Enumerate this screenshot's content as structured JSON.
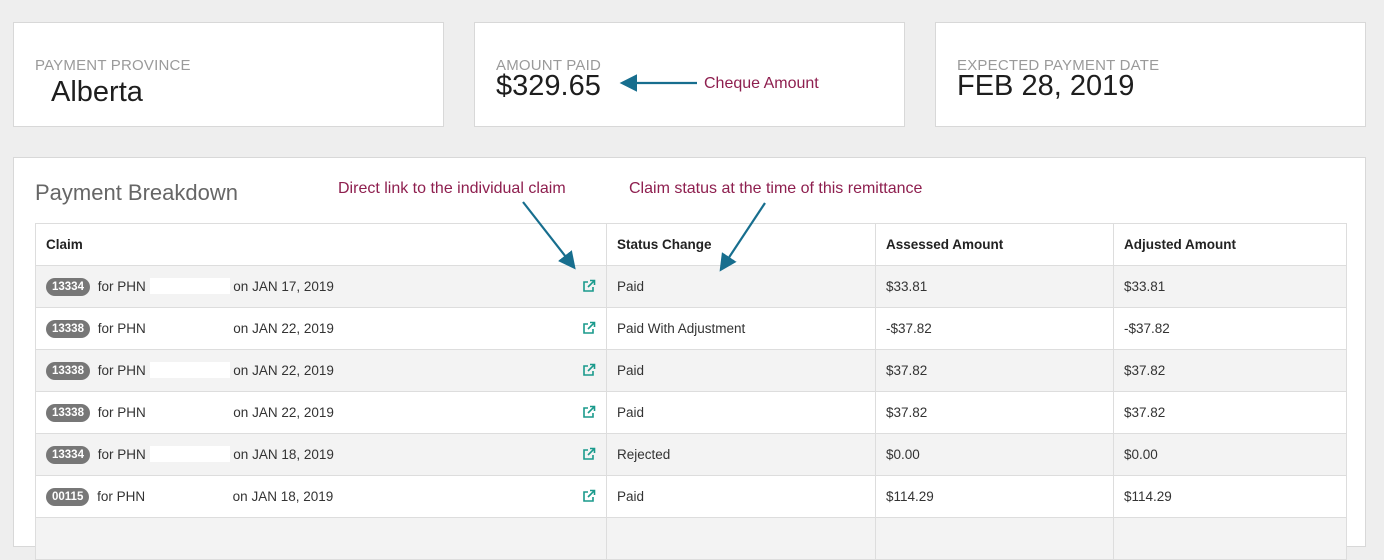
{
  "summary": {
    "province": {
      "label": "PAYMENT PROVINCE",
      "value": "Alberta"
    },
    "amount": {
      "label": "AMOUNT PAID",
      "value": "$329.65",
      "annotation": "Cheque Amount"
    },
    "date": {
      "label": "EXPECTED PAYMENT DATE",
      "value": "FEB 28, 2019"
    }
  },
  "breakdown": {
    "title": "Payment Breakdown",
    "annotations": {
      "link": "Direct link to the individual claim",
      "status": "Claim status at the time of this remittance"
    },
    "columns": [
      "Claim",
      "Status Change",
      "Assessed Amount",
      "Adjusted Amount"
    ],
    "rows": [
      {
        "claim_id": "13334",
        "phn_prefix": "for PHN",
        "date_text": "on JAN 17, 2019",
        "status": "Paid",
        "assessed": "$33.81",
        "adjusted": "$33.81"
      },
      {
        "claim_id": "13338",
        "phn_prefix": "for PHN",
        "date_text": "on JAN 22, 2019",
        "status": "Paid With Adjustment",
        "assessed": "-$37.82",
        "adjusted": "-$37.82"
      },
      {
        "claim_id": "13338",
        "phn_prefix": "for PHN",
        "date_text": "on JAN 22, 2019",
        "status": "Paid",
        "assessed": "$37.82",
        "adjusted": "$37.82"
      },
      {
        "claim_id": "13338",
        "phn_prefix": "for PHN",
        "date_text": "on JAN 22, 2019",
        "status": "Paid",
        "assessed": "$37.82",
        "adjusted": "$37.82"
      },
      {
        "claim_id": "13334",
        "phn_prefix": "for PHN",
        "date_text": "on JAN 18, 2019",
        "status": "Rejected",
        "assessed": "$0.00",
        "adjusted": "$0.00"
      },
      {
        "claim_id": "00115",
        "phn_prefix": "for PHN",
        "date_text": "on JAN 18, 2019",
        "status": "Paid",
        "assessed": "$114.29",
        "adjusted": "$114.29"
      }
    ]
  },
  "colors": {
    "annotation_text": "#8e1f4f",
    "annotation_arrow": "#176e8e",
    "link_icon": "#1a9a8c",
    "badge": "#777777"
  },
  "icons": {
    "external_link": "external-link-icon",
    "arrow": "arrow-icon"
  }
}
